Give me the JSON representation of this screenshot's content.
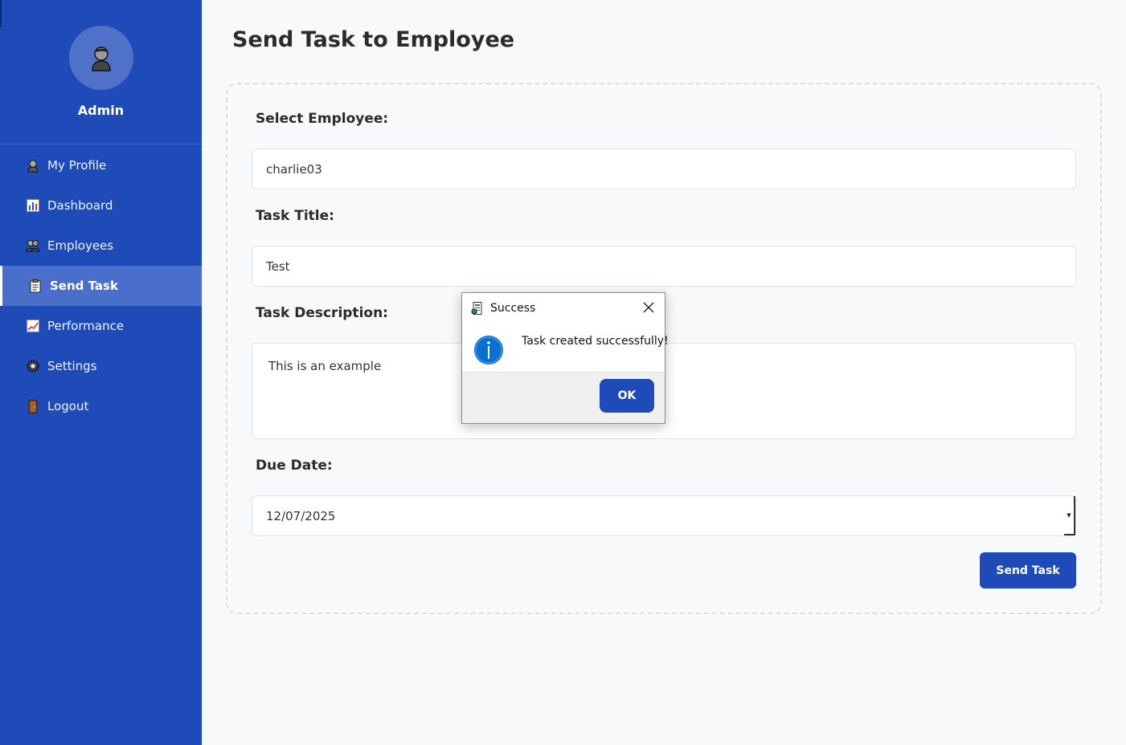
{
  "sidebar": {
    "user_name": "Admin",
    "items": [
      {
        "label": "My Profile",
        "icon": "profile-icon"
      },
      {
        "label": "Dashboard",
        "icon": "bar-chart-icon"
      },
      {
        "label": "Employees",
        "icon": "people-icon"
      },
      {
        "label": "Send Task",
        "icon": "clipboard-icon",
        "active": true
      },
      {
        "label": "Performance",
        "icon": "trend-chart-icon"
      },
      {
        "label": "Settings",
        "icon": "gear-icon"
      },
      {
        "label": "Logout",
        "icon": "door-icon"
      }
    ]
  },
  "main": {
    "title": "Send Task to Employee",
    "form": {
      "employee_label": "Select Employee:",
      "employee_value": "charlie03",
      "title_label": "Task Title:",
      "title_value": "Test",
      "description_label": "Task Description:",
      "description_value": "This is an example",
      "due_label": "Due Date:",
      "due_value": "12/07/2025",
      "submit_label": "Send Task"
    }
  },
  "dialog": {
    "title": "Success",
    "message": "Task created successfully!",
    "ok_label": "OK"
  },
  "colors": {
    "sidebar": "#1e4bb8",
    "accent": "#1e4bb8",
    "active_item": "#4a6fca",
    "info_icon": "#0b6fd0"
  }
}
